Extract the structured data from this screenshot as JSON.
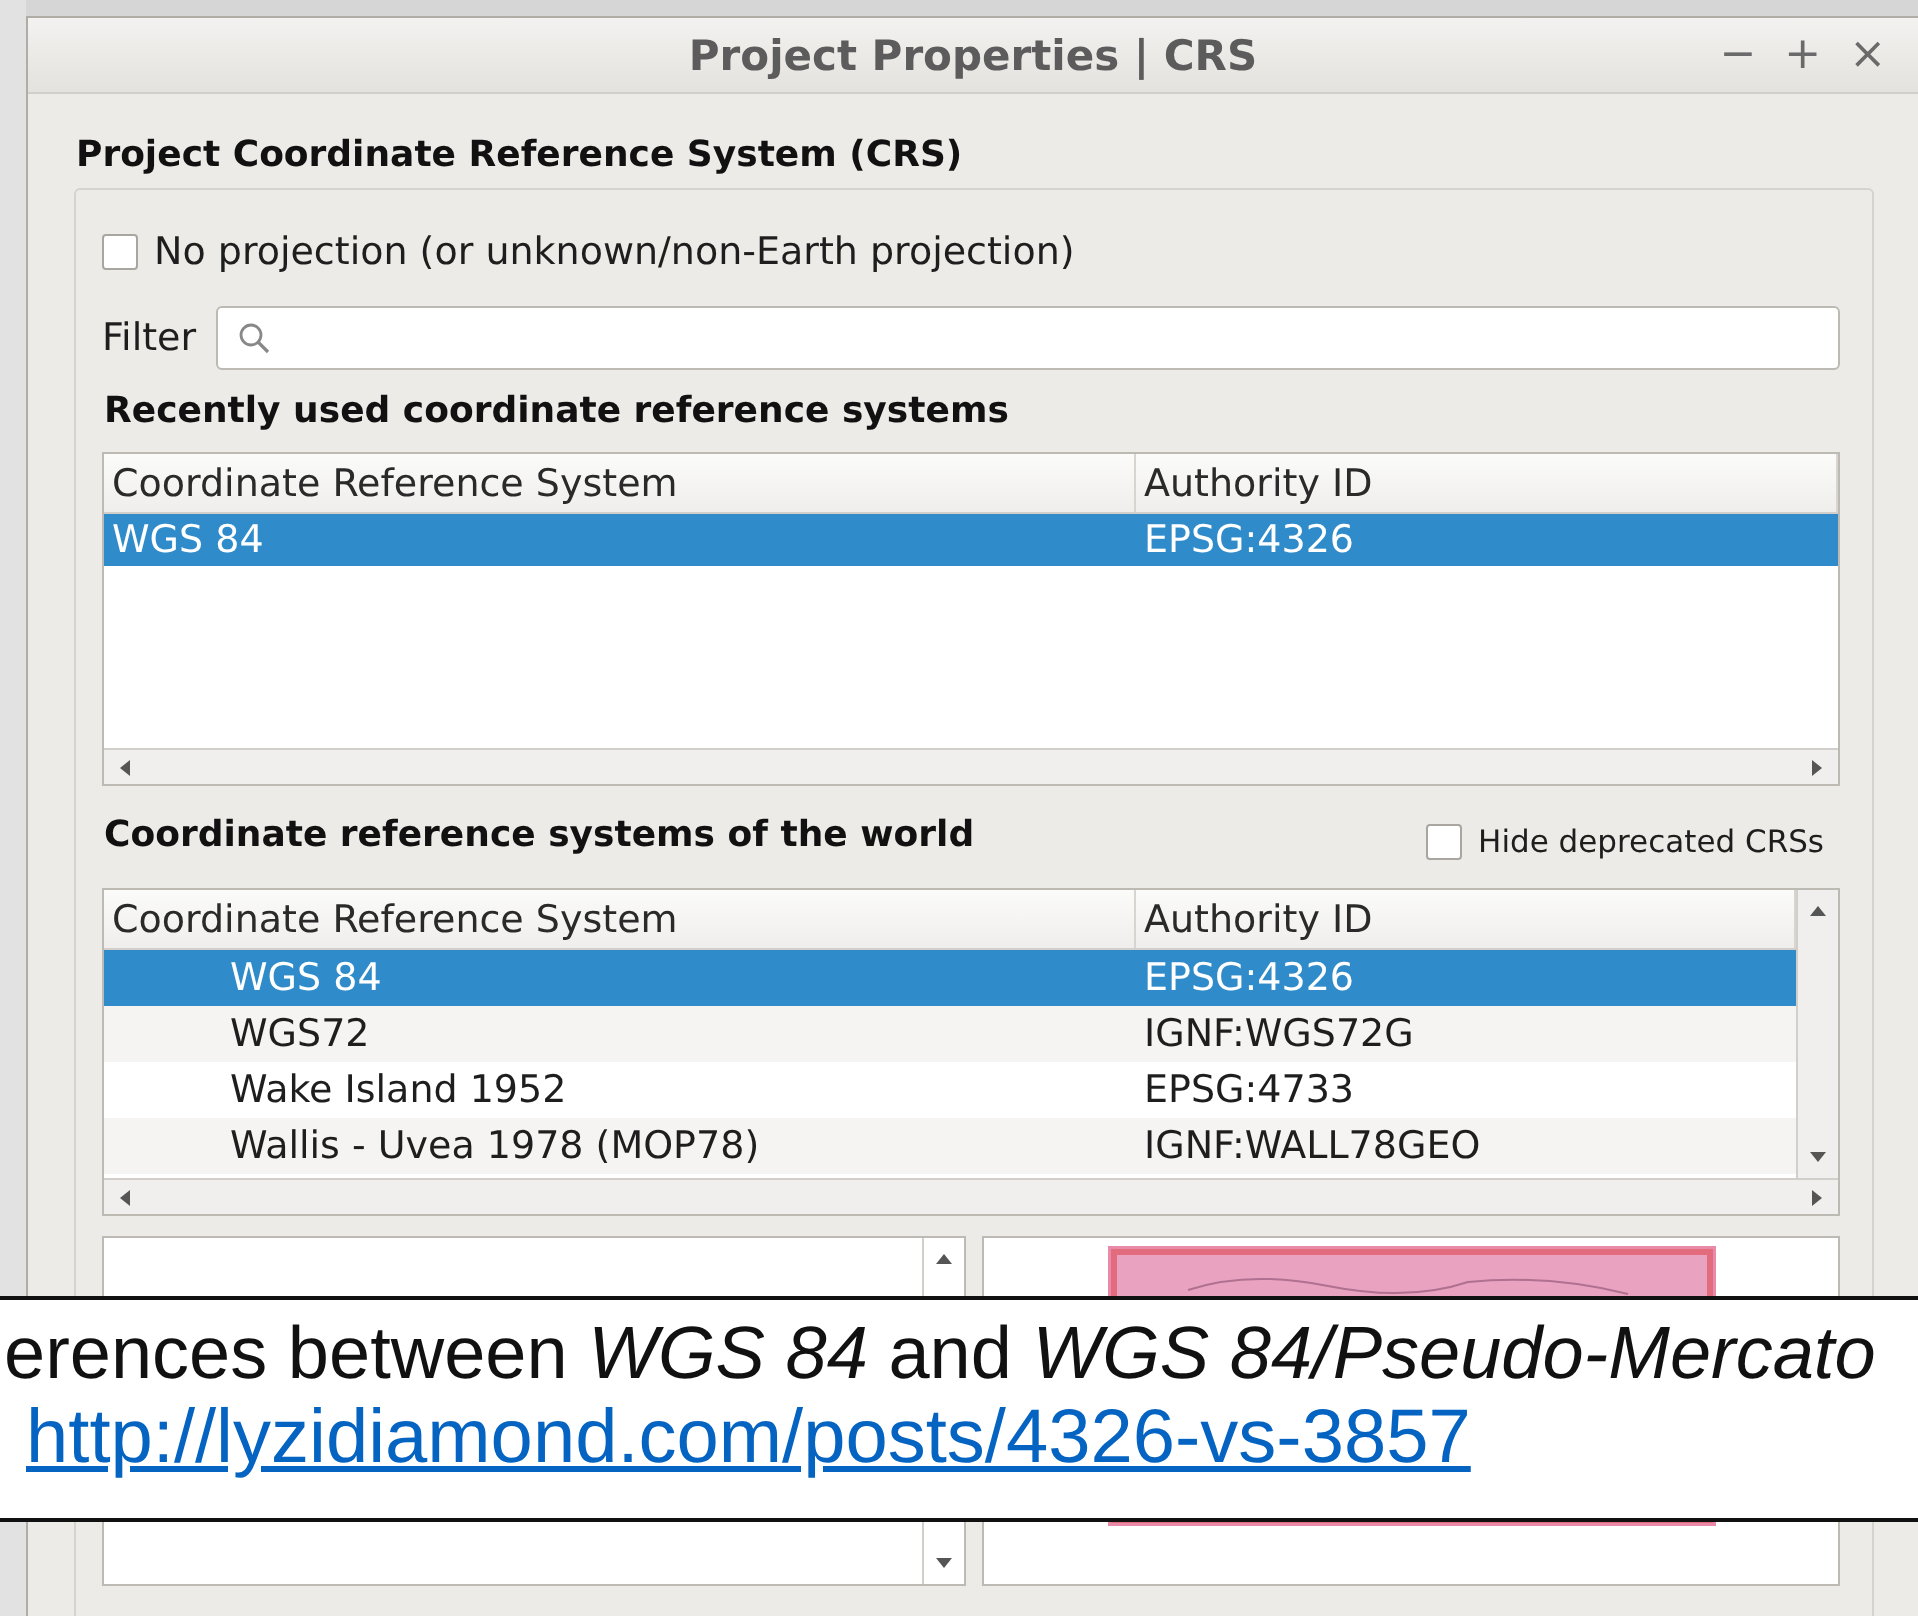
{
  "window": {
    "title": "Project Properties | CRS",
    "controls": [
      "−",
      "+",
      "×"
    ]
  },
  "section_title": "Project Coordinate Reference System (CRS)",
  "no_projection": {
    "label": "No projection (or unknown/non-Earth projection)",
    "checked": false
  },
  "filter": {
    "label": "Filter"
  },
  "recent": {
    "title": "Recently used coordinate reference systems",
    "columns": [
      "Coordinate Reference System",
      "Authority ID"
    ],
    "rows": [
      {
        "name": "WGS 84",
        "authority_id": "EPSG:4326",
        "selected": true
      }
    ]
  },
  "world": {
    "title": "Coordinate reference systems of the world",
    "hide_deprecated": {
      "label": "Hide deprecated CRSs",
      "checked": false
    },
    "columns": [
      "Coordinate Reference System",
      "Authority ID"
    ],
    "rows": [
      {
        "name": "WGS 84",
        "authority_id": "EPSG:4326",
        "selected": true
      },
      {
        "name": "WGS72",
        "authority_id": "IGNF:WGS72G",
        "selected": false
      },
      {
        "name": "Wake Island 1952",
        "authority_id": "EPSG:4733",
        "selected": false
      },
      {
        "name": "Wallis - Uvea 1978 (MOP78)",
        "authority_id": "IGNF:WALL78GEO",
        "selected": false
      }
    ]
  },
  "caption": {
    "text": "erences between *WGS 84* and *WGS 84/Pseudo-Mercato*",
    "link": "http://lyzidiamond.com/posts/4326-vs-3857"
  }
}
